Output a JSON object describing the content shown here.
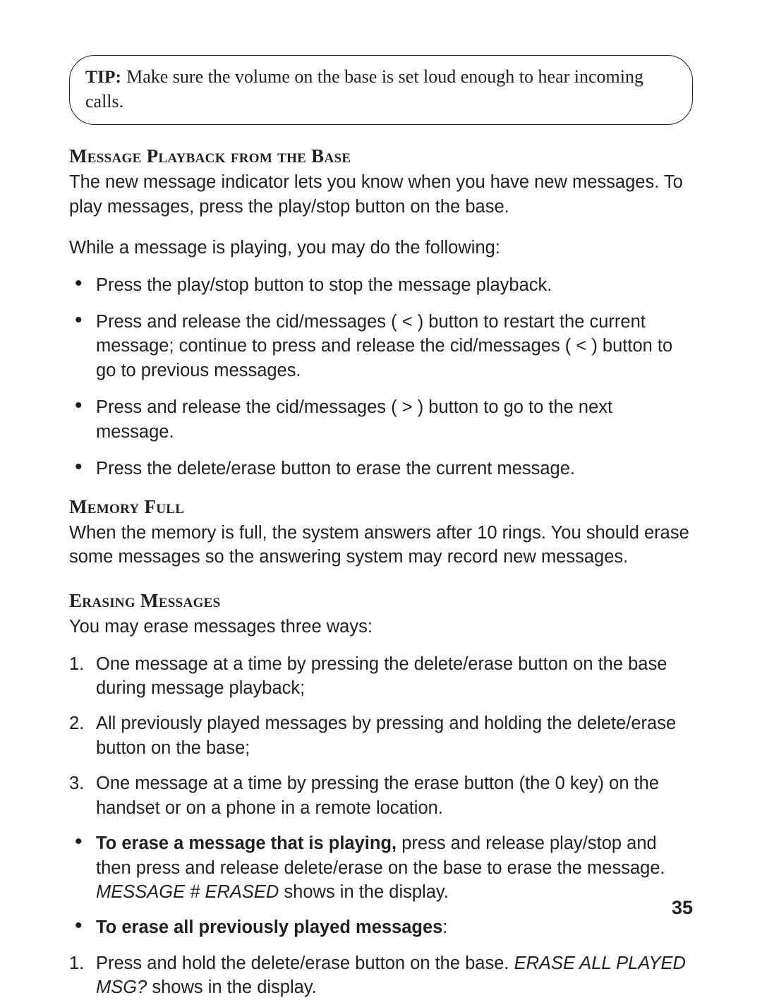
{
  "tip": {
    "label": "TIP:",
    "text": "Make sure the volume on the base is set loud enough to hear incoming calls."
  },
  "playback": {
    "heading": "Message Playback from the Base",
    "intro": "The new message indicator lets you know when you have new messages. To play messages, press the play/stop button on the base.",
    "while_playing": "While a message is playing, you may do the following:",
    "bullets": [
      "Press the play/stop button to stop the message playback.",
      "Press and release the cid/messages ( < ) button to restart the current message; continue to press and release the cid/messages ( < ) button to go to previous messages.",
      "Press and release the cid/messages ( > ) button to go to the next message.",
      "Press the delete/erase button to erase the current message."
    ]
  },
  "memory_full": {
    "heading": "Memory Full",
    "body": "When the memory is full, the system answers after 10 rings. You should erase some messages so the answering system may record new messages."
  },
  "erasing": {
    "heading": "Erasing Messages",
    "intro": "You may erase messages three ways:",
    "steps": [
      "One message at a time by pressing the delete/erase button on the base during message playback;",
      "All previously played messages by pressing and holding the delete/erase button on the base;",
      "One message at a time by pressing the erase button (the 0 key) on the handset or on a phone in a remote location."
    ],
    "bullet1": {
      "bold": "To erase a message that is playing,",
      "rest": " press and release play/stop and then press and release delete/erase on the base to erase the message. ",
      "italic": "MESSAGE # ERASED",
      "after_italic": " shows in the display."
    },
    "bullet2": {
      "bold": "To erase all previously played messages",
      "colon": ":"
    },
    "substep": {
      "num": "1.",
      "pre": "Press and hold the delete/erase button on the base. ",
      "italic": "ERASE ALL PLAYED MSG?",
      "after_italic": " shows in the display."
    }
  },
  "page_number": "35"
}
